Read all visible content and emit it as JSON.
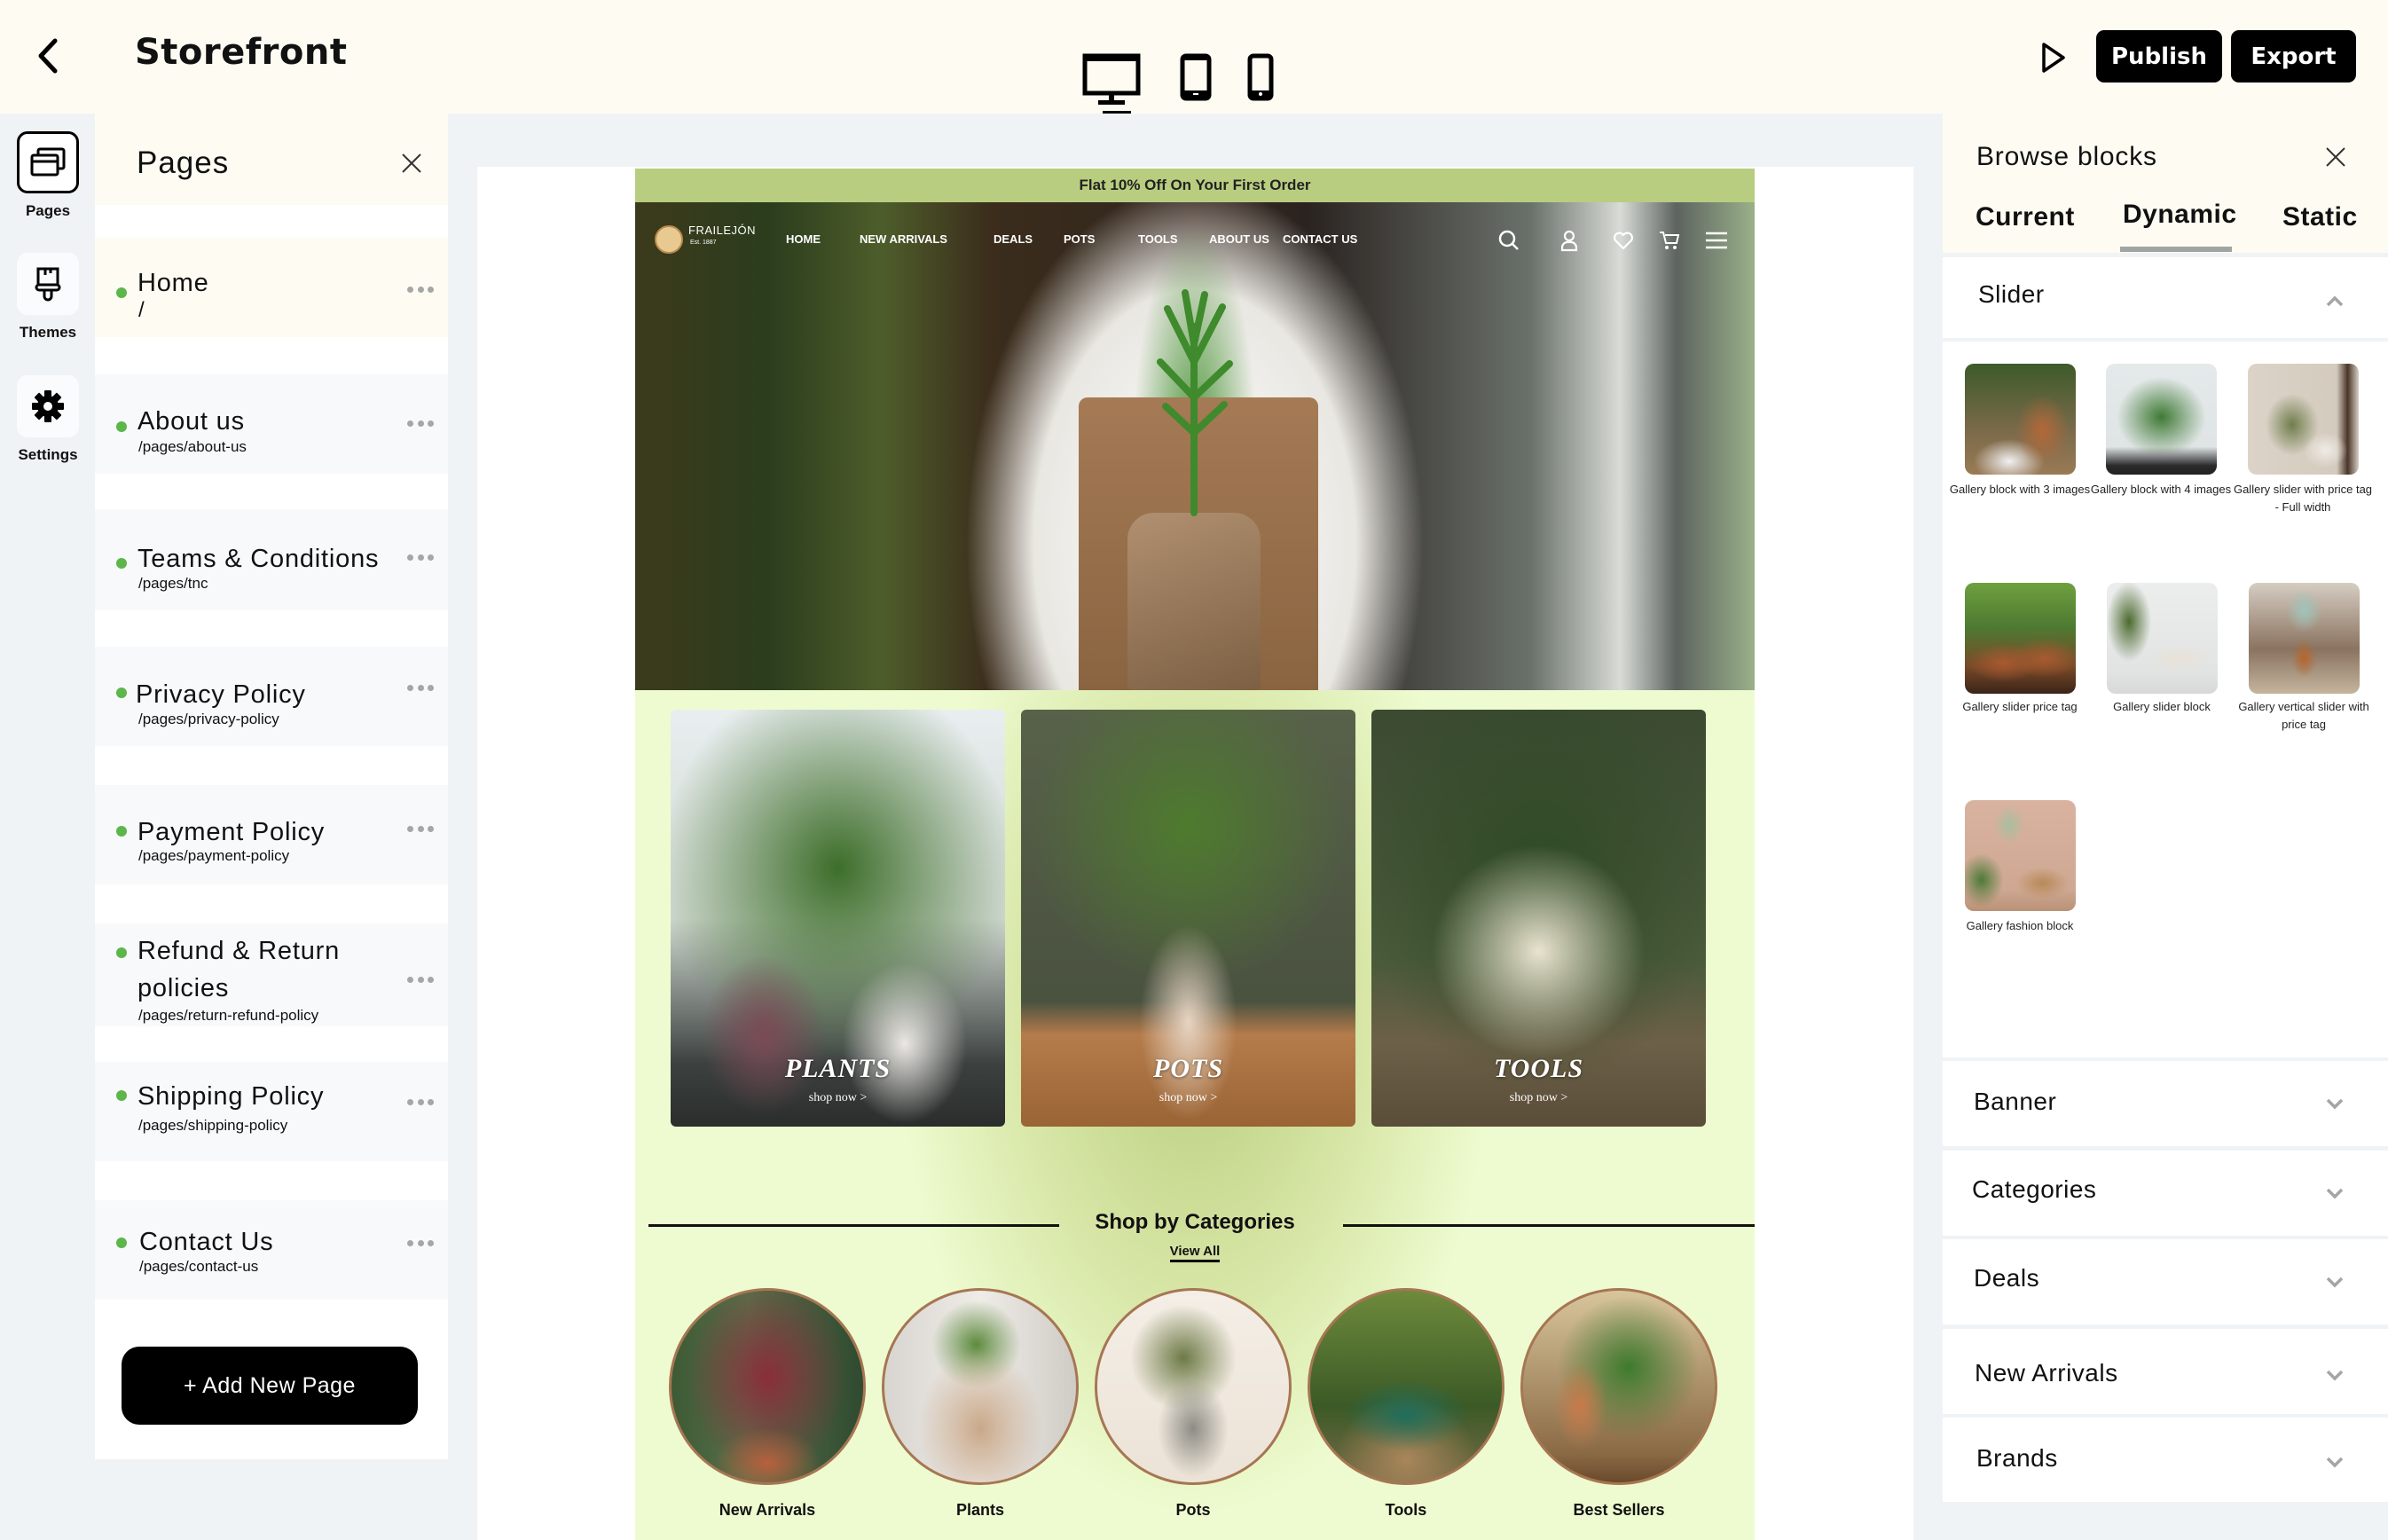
{
  "topbar": {
    "title": "Storefront",
    "back_icon": "chevron-left-icon",
    "devices": [
      {
        "name": "desktop",
        "icon": "monitor-icon",
        "selected": true
      },
      {
        "name": "tablet",
        "icon": "tablet-icon",
        "selected": false
      },
      {
        "name": "mobile",
        "icon": "phone-icon",
        "selected": false
      }
    ],
    "preview_icon": "play-icon",
    "publish_label": "Publish",
    "export_label": "Export"
  },
  "rail": {
    "items": [
      {
        "label": "Pages",
        "icon": "pages-icon",
        "active": true
      },
      {
        "label": "Themes",
        "icon": "paintbrush-icon",
        "active": false
      },
      {
        "label": "Settings",
        "icon": "gear-icon",
        "active": false
      }
    ]
  },
  "pages_panel": {
    "title": "Pages",
    "close_icon": "close-icon",
    "pages": [
      {
        "name": "Home",
        "path": "/",
        "active": true
      },
      {
        "name": "About us",
        "path": "/pages/about-us"
      },
      {
        "name": "Teams & Conditions",
        "path": "/pages/tnc"
      },
      {
        "name": "Privacy Policy",
        "path": "/pages/privacy-policy"
      },
      {
        "name": "Payment Policy",
        "path": "/pages/payment-policy"
      },
      {
        "name": "Refund & Return policies",
        "path": "/pages/return-refund-policy"
      },
      {
        "name": "Shipping Policy",
        "path": "/pages/shipping-policy"
      },
      {
        "name": "Contact Us",
        "path": "/pages/contact-us"
      }
    ],
    "status_color": "#5cb64a",
    "add_page_label": "+ Add New Page"
  },
  "storefront": {
    "promo": "Flat 10% Off On Your First Order",
    "brand": "FRAILEJÓN",
    "brand_sub": "Est. 1887",
    "nav": [
      "HOME",
      "NEW ARRIVALS",
      "DEALS",
      "POTS",
      "TOOLS",
      "ABOUT US",
      "CONTACT US"
    ],
    "nav_icons": [
      "search-icon",
      "user-icon",
      "heart-icon",
      "cart-icon",
      "menu-icon"
    ],
    "category_cards": [
      {
        "title": "PLANTS",
        "cta": "shop now >"
      },
      {
        "title": "POTS",
        "cta": "shop now >"
      },
      {
        "title": "TOOLS",
        "cta": "shop now >"
      }
    ],
    "shop_by_title": "Shop by Categories",
    "view_all": "View All",
    "circles": [
      "New Arrivals",
      "Plants",
      "Pots",
      "Tools",
      "Best Sellers"
    ]
  },
  "blocks_panel": {
    "title": "Browse blocks",
    "close_icon": "close-icon",
    "tabs": [
      {
        "label": "Current",
        "active": false
      },
      {
        "label": "Dynamic",
        "active": true
      },
      {
        "label": "Static",
        "active": false
      }
    ],
    "sections": [
      {
        "title": "Slider",
        "expanded": true,
        "items": [
          "Gallery block with 3 images",
          "Gallery block with 4 images",
          "Gallery slider with price tag - Full width",
          "Gallery slider price tag",
          "Gallery slider block",
          "Gallery vertical slider with price tag",
          "Gallery fashion block"
        ]
      },
      {
        "title": "Banner",
        "expanded": false
      },
      {
        "title": "Categories",
        "expanded": false
      },
      {
        "title": "Deals",
        "expanded": false
      },
      {
        "title": "New Arrivals",
        "expanded": false
      },
      {
        "title": "Brands",
        "expanded": false
      }
    ]
  }
}
